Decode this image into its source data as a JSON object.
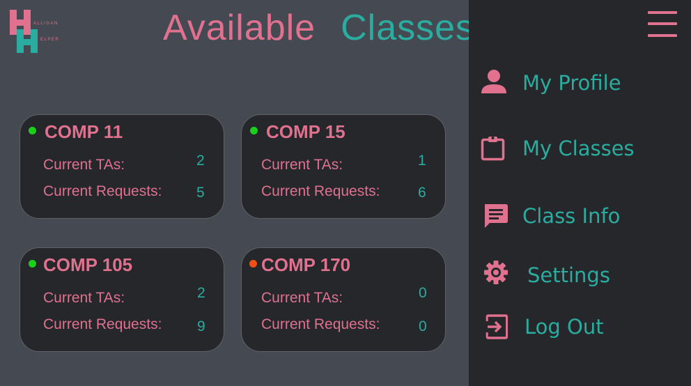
{
  "logo": {
    "line1": "ALLIGAN",
    "line2": "ELPER"
  },
  "title": {
    "word1": "Available",
    "word2": "Classes"
  },
  "card_labels": {
    "tas": "Current TAs:",
    "requests": "Current Requests:"
  },
  "classes": [
    {
      "name": "COMP 11",
      "status": "online",
      "tas": "2",
      "requests": "5"
    },
    {
      "name": "COMP 15",
      "status": "online",
      "tas": "1",
      "requests": "6"
    },
    {
      "name": "COMP 105",
      "status": "online",
      "tas": "2",
      "requests": "9"
    },
    {
      "name": "COMP 170",
      "status": "offline",
      "tas": "0",
      "requests": "0"
    }
  ],
  "colors": {
    "pink": "#e0718f",
    "teal": "#2aada0",
    "online": "#19d119",
    "offline": "#f05016",
    "background": "#454951",
    "drawer": "#25272b"
  },
  "nav": [
    {
      "label": "My Profile",
      "icon": "person-icon"
    },
    {
      "label": "My Classes",
      "icon": "clipboard-icon"
    },
    {
      "label": "Class Info",
      "icon": "chat-bubble-icon"
    },
    {
      "label": "Settings",
      "icon": "gear-icon"
    },
    {
      "label": "Log Out",
      "icon": "logout-icon"
    }
  ],
  "menu_icon": "hamburger-menu-icon"
}
